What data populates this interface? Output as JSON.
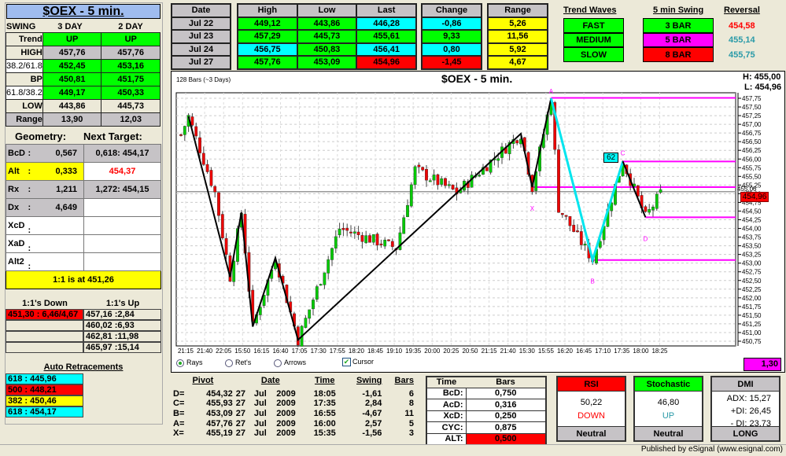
{
  "title": "$OEX - 5 min.",
  "swing": {
    "label": "SWING",
    "col1": "3 DAY",
    "col2": "2 DAY",
    "rows": [
      {
        "label": "Trend",
        "v1": "UP",
        "v2": "UP"
      },
      {
        "label": "HIGH",
        "v1": "457,76",
        "v2": "457,76"
      },
      {
        "label": "38.2/61.8",
        "v1": "452,45",
        "v2": "453,16"
      },
      {
        "label": "BP",
        "v1": "450,81",
        "v2": "451,75"
      },
      {
        "label": "61.8/38.2",
        "v1": "449,17",
        "v2": "450,33"
      },
      {
        "label": "LOW",
        "v1": "443,86",
        "v2": "445,73"
      },
      {
        "label": "Range",
        "v1": "13,90",
        "v2": "12,03"
      }
    ]
  },
  "geometry": {
    "label": "Geometry:",
    "next_label": "Next Target:",
    "rows": [
      {
        "k": "BcD",
        "v": "0,567",
        "t": "0,618: 454,17"
      },
      {
        "k": "Alt",
        "v": "0,333",
        "t": "454,37"
      },
      {
        "k": "Rx",
        "v": "1,211",
        "t": "1,272: 454,15"
      },
      {
        "k": "Dx",
        "v": "4,649",
        "t": ""
      },
      {
        "k": "XcD",
        "v": "",
        "t": ""
      },
      {
        "k": "XaD",
        "v": "",
        "t": ""
      },
      {
        "k": "Alt2",
        "v": "",
        "t": ""
      }
    ],
    "colon": ":",
    "footer": "1:1 is at 451,26"
  },
  "one_one": {
    "down_label": "1:1's Down",
    "up_label": "1:1's Up",
    "down": [
      "451,30 : 6,46/4,67",
      "",
      "",
      ""
    ],
    "up": [
      "457,16 :2,84",
      "460,02 :6,93",
      "462,81 :11,98",
      "465,97 :15,14"
    ]
  },
  "retracements": {
    "label": "Auto Retracements",
    "items": [
      "618 : 445,96",
      "500 : 448,21",
      "382 : 450,46",
      "618 : 454,17"
    ]
  },
  "daily": {
    "headers": [
      "Date",
      "High",
      "Low",
      "Last",
      "Change",
      "Range"
    ],
    "rows": [
      [
        "Jul  22",
        "449,12",
        "443,86",
        "446,28",
        "-0,86",
        "5,26"
      ],
      [
        "Jul  23",
        "457,29",
        "445,73",
        "455,61",
        "9,33",
        "11,56"
      ],
      [
        "Jul  24",
        "456,75",
        "450,83",
        "456,41",
        "0,80",
        "5,92"
      ],
      [
        "Jul  27",
        "457,76",
        "453,09",
        "454,96",
        "-1,45",
        "4,67"
      ]
    ]
  },
  "waves": {
    "trend_label": "Trend Waves",
    "swing_label": "5 min Swing",
    "rev_label": "Reversal",
    "trend": [
      "FAST",
      "MEDIUM",
      "SLOW"
    ],
    "swing": [
      "3 BAR",
      "5 BAR",
      "8 BAR"
    ],
    "reversal": [
      "454,58",
      "455,14",
      "455,75"
    ]
  },
  "chart": {
    "bars_label": "128 Bars (~3 Days)",
    "title": "$OEX - 5 min.",
    "high": "H:  455,00",
    "low": "L:  454,96",
    "last_tag": "454,96",
    "line_tag": "455,06",
    "box_62": "62",
    "value_box": "1,30",
    "options": {
      "rays": "Rays",
      "refs": "Ret's",
      "arrows": "Arrows",
      "cursor": "Cursor"
    },
    "pivots": {
      "X": "X",
      "A": "A",
      "B": "B",
      "C": "C",
      "D": "D"
    }
  },
  "chart_data": {
    "type": "candlestick",
    "ylim": [
      450.75,
      457.75
    ],
    "ystep": 0.25,
    "bars": 128,
    "xticks": [
      "21:15",
      "21:40",
      "22:05",
      "15:50",
      "16:15",
      "16:40",
      "17:05",
      "17:30",
      "17:55",
      "18:20",
      "18:45",
      "19:10",
      "19:35",
      "20:00",
      "20:25",
      "20:50",
      "21:15",
      "21:40",
      "15:30",
      "15:55",
      "16:20",
      "16:45",
      "17:10",
      "17:35",
      "18:00",
      "18:25"
    ],
    "path": [
      [
        0,
        456.7
      ],
      [
        2,
        457.23
      ],
      [
        9,
        455.03
      ],
      [
        13,
        452.6
      ],
      [
        16,
        454.46
      ],
      [
        19,
        451.17
      ],
      [
        25,
        453.15
      ],
      [
        31,
        450.79
      ],
      [
        42,
        454.0
      ],
      [
        57,
        453.44
      ],
      [
        62,
        455.7
      ],
      [
        73,
        455.03
      ],
      [
        90,
        456.73
      ],
      [
        93,
        455.19
      ],
      [
        98,
        457.75
      ],
      [
        100,
        454.6
      ],
      [
        109,
        453.09
      ],
      [
        117,
        455.93
      ],
      [
        123,
        454.32
      ],
      [
        127,
        455.0
      ]
    ],
    "black_zigzag": [
      [
        2,
        457.23
      ],
      [
        13,
        452.6
      ],
      [
        16,
        454.46
      ],
      [
        19,
        451.17
      ],
      [
        25,
        453.15
      ],
      [
        31,
        450.79
      ],
      [
        90,
        456.73
      ],
      [
        93,
        455.19
      ],
      [
        98,
        457.75
      ]
    ],
    "cyan_zigzag": [
      [
        98,
        457.75
      ],
      [
        109,
        453.09
      ],
      [
        117,
        455.93
      ]
    ],
    "cd_line": [
      [
        117,
        455.93
      ],
      [
        123,
        454.32
      ]
    ],
    "levels": [
      {
        "from": 98,
        "price": 457.76
      },
      {
        "from": 117,
        "price": 455.93
      },
      {
        "from": 93,
        "price": 455.19
      },
      {
        "from": 123,
        "price": 454.32
      },
      {
        "from": 109,
        "price": 453.09
      }
    ],
    "current_line": 455.06
  },
  "pivot_table": {
    "headers": [
      "Pivot",
      "Date",
      "Time",
      "Swing",
      "Bars"
    ],
    "rows": [
      [
        "D=",
        "454,32",
        "27",
        "Jul",
        "2009",
        "18:05",
        "-1,61",
        "6"
      ],
      [
        "C=",
        "455,93",
        "27",
        "Jul",
        "2009",
        "17:35",
        "2,84",
        "8"
      ],
      [
        "B=",
        "453,09",
        "27",
        "Jul",
        "2009",
        "16:55",
        "-4,67",
        "11"
      ],
      [
        "A=",
        "457,76",
        "27",
        "Jul",
        "2009",
        "16:00",
        "2,57",
        "5"
      ],
      [
        "X=",
        "455,19",
        "27",
        "Jul",
        "2009",
        "15:35",
        "-1,56",
        "3"
      ]
    ]
  },
  "time_bars": {
    "headers": [
      "Time",
      "Bars"
    ],
    "rows": [
      [
        "BcD:",
        "0,750"
      ],
      [
        "AcD:",
        "0,316"
      ],
      [
        "XcD:",
        "0,250"
      ],
      [
        "CYC:",
        "0,875"
      ],
      [
        "ALT:",
        "0,500"
      ]
    ]
  },
  "rsi": {
    "title": "RSI",
    "value": "50,22",
    "dir": "DOWN",
    "status": "Neutral"
  },
  "stoch": {
    "title": "Stochastic",
    "value": "46,80",
    "dir": "UP",
    "status": "Neutral"
  },
  "dmi": {
    "title": "DMI",
    "adx": "ADX:  15,27",
    "pdi": "+DI:  26,45",
    "mdi": "- DI:  23,73",
    "status": "LONG"
  },
  "footer": "Published by eSignal (www.esignal.com)",
  "colors": {
    "green": "#00ff00",
    "red": "#ff0000",
    "cyan": "#00ffff",
    "yellow": "#ffff00",
    "magenta": "#ff00ff"
  }
}
